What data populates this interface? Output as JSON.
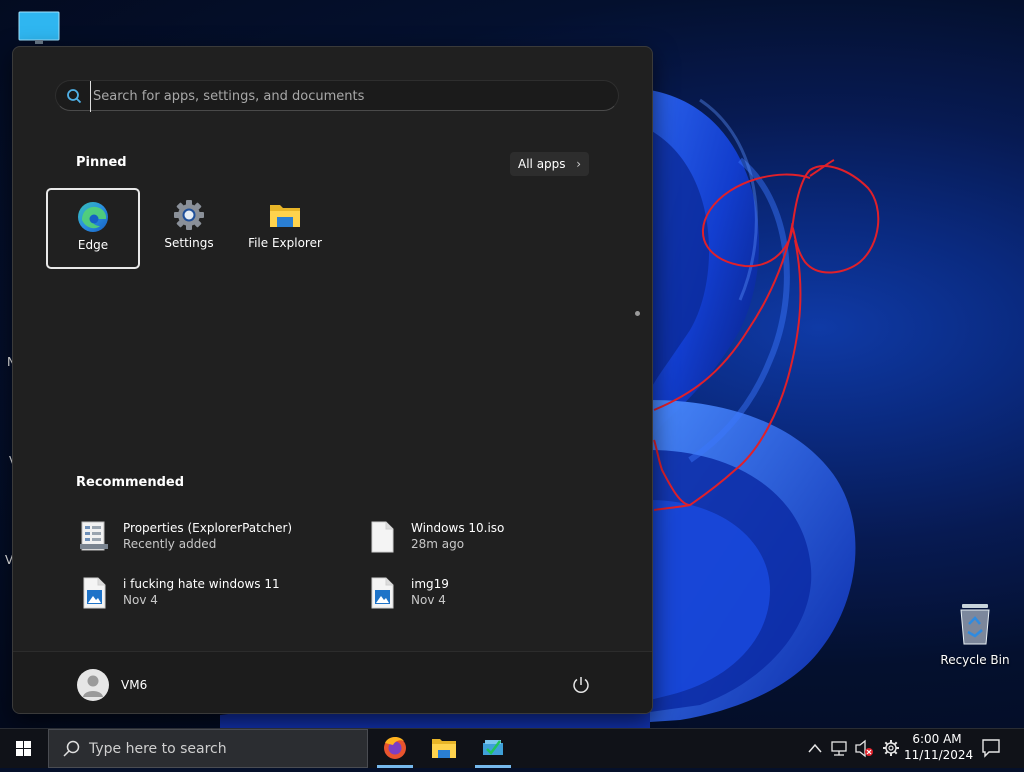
{
  "desktop": {
    "icons": [
      {
        "name": "this-pc",
        "label": ""
      },
      {
        "name": "recycle-bin",
        "label": "Recycle Bin"
      }
    ],
    "edge_letters": [
      "N",
      "V",
      "V"
    ]
  },
  "start_menu": {
    "search": {
      "placeholder": "Search for apps, settings, and documents",
      "value": ""
    },
    "pinned": {
      "title": "Pinned",
      "all_apps_label": "All apps",
      "apps": [
        {
          "label": "Edge",
          "icon": "edge-icon"
        },
        {
          "label": "Settings",
          "icon": "gear-icon"
        },
        {
          "label": "File Explorer",
          "icon": "folder-icon"
        }
      ]
    },
    "recommended": {
      "title": "Recommended",
      "items": [
        {
          "name": "Properties (ExplorerPatcher)",
          "sub": "Recently added",
          "icon": "app-window-icon"
        },
        {
          "name": "Windows 10.iso",
          "sub": "28m ago",
          "icon": "file-icon"
        },
        {
          "name": "i fucking hate windows 11",
          "sub": "Nov 4",
          "icon": "image-file-icon"
        },
        {
          "name": "img19",
          "sub": "Nov 4",
          "icon": "image-file-icon"
        }
      ]
    },
    "user": {
      "name": "VM6"
    }
  },
  "taskbar": {
    "search_text": "Type here to search",
    "apps": [
      "firefox-icon",
      "file-explorer-icon",
      "app-icon"
    ],
    "tray": [
      "chevron-up-icon",
      "network-icon",
      "volume-muted-icon",
      "gear-icon"
    ],
    "time": "6:00 AM",
    "date": "11/11/2024"
  },
  "colors": {
    "accent": "#76b9ed",
    "scribble": "#e0202a",
    "menu_bg": "#202020"
  }
}
